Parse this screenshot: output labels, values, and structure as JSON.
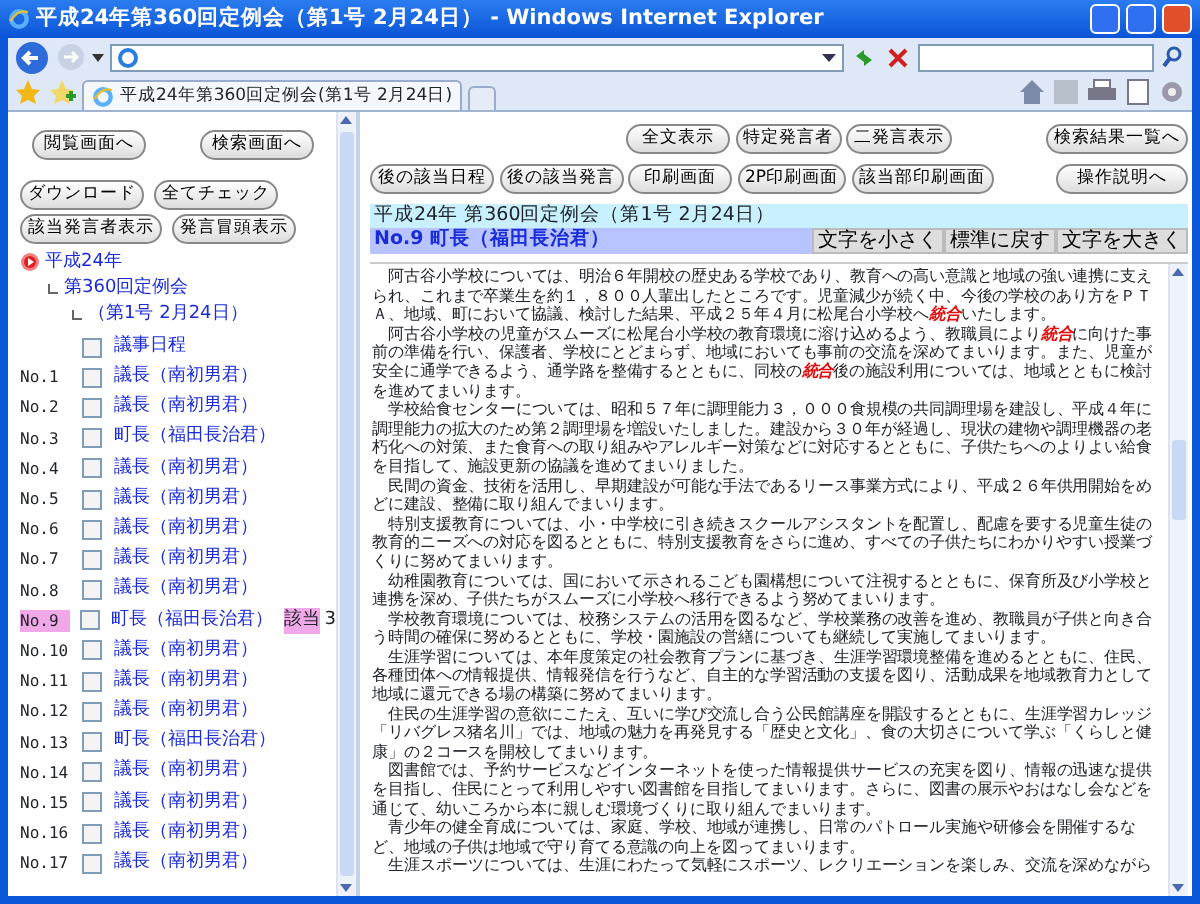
{
  "window": {
    "title": "平成24年第360回定例会（第1号 2月24日） - Windows Internet Explorer"
  },
  "browser": {
    "tab_title": "平成24年第360回定例会(第1号 2月24日)"
  },
  "left_panel": {
    "nav_buttons": [
      "閲覧画面へ",
      "検索画面へ"
    ],
    "tool_buttons": [
      [
        "ダウンロード",
        "全てチェック"
      ],
      [
        "該当発言者表示",
        "発言冒頭表示"
      ]
    ],
    "tree": [
      {
        "label": "平成24年",
        "children": [
          {
            "label": "第360回定例会",
            "children": [
              {
                "label": "（第1号 2月24日）"
              }
            ]
          }
        ]
      }
    ],
    "items": [
      {
        "label": "議事日程",
        "checked": false,
        "selected": false
      },
      {
        "number": "No.1",
        "label": "議長（南初男君）",
        "checked": false,
        "selected": false
      },
      {
        "number": "No.2",
        "label": "議長（南初男君）",
        "checked": false,
        "selected": false
      },
      {
        "number": "No.3",
        "label": "町長（福田長治君）",
        "checked": false,
        "selected": false
      },
      {
        "number": "No.4",
        "label": "議長（南初男君）",
        "checked": false,
        "selected": false
      },
      {
        "number": "No.5",
        "label": "議長（南初男君）",
        "checked": false,
        "selected": false
      },
      {
        "number": "No.6",
        "label": "議長（南初男君）",
        "checked": false,
        "selected": false
      },
      {
        "number": "No.7",
        "label": "議長（南初男君）",
        "checked": false,
        "selected": false
      },
      {
        "number": "No.8",
        "label": "議長（南初男君）",
        "checked": false,
        "selected": false
      },
      {
        "number": "No.9",
        "label": "町長（福田長治君）",
        "checked": false,
        "selected": true,
        "hit_label": "該当",
        "hit_count": "3"
      },
      {
        "number": "No.10",
        "label": "議長（南初男君）",
        "checked": false,
        "selected": false
      },
      {
        "number": "No.11",
        "label": "議長（南初男君）",
        "checked": false,
        "selected": false
      },
      {
        "number": "No.12",
        "label": "議長（南初男君）",
        "checked": false,
        "selected": false
      },
      {
        "number": "No.13",
        "label": "町長（福田長治君）",
        "checked": false,
        "selected": false
      },
      {
        "number": "No.14",
        "label": "議長（南初男君）",
        "checked": false,
        "selected": false
      },
      {
        "number": "No.15",
        "label": "議長（南初男君）",
        "checked": false,
        "selected": false
      },
      {
        "number": "No.16",
        "label": "議長（南初男君）",
        "checked": false,
        "selected": false
      },
      {
        "number": "No.17",
        "label": "議長（南初男君）",
        "checked": false,
        "selected": false
      }
    ]
  },
  "right_panel": {
    "button_rows": [
      [
        "全文表示",
        "特定発言者",
        "二発言表示",
        "検索結果一覧へ"
      ],
      [
        "後の該当日程",
        "後の該当発言",
        "印刷画面",
        "2P印刷画面",
        "該当部印刷画面",
        "操作説明へ"
      ]
    ],
    "session_title": "平成24年 第360回定例会（第1号 2月24日）",
    "speaker": "No.9 町長（福田長治君）",
    "font_buttons": [
      "文字を小さく",
      "標準に戻す",
      "文字を大きく"
    ],
    "paragraphs": [
      "阿古谷小学校については、明治６年開校の歴史ある学校であり、教育への高い意識と地域の強い連携に支えられ、これまで卒業生を約１，８００人輩出したところです。児童減少が続く中、今後の学校のあり方をＰＴＡ、地域、町において協議、検討した結果、平成２５年４月に松尾台小学校へ**統合**いたします。",
      "阿古谷小学校の児童がスムーズに松尾台小学校の教育環境に溶け込めるよう、教職員により**統合**に向けた事前の準備を行い、保護者、学校にとどまらず、地域においても事前の交流を深めてまいります。また、児童が安全に通学できるよう、通学路を整備するとともに、同校の**統合**後の施設利用については、地域とともに検討を進めてまいります。",
      "学校給食センターについては、昭和５７年に調理能力３，０００食規模の共同調理場を建設し、平成４年に調理能力の拡大のため第２調理場を増設いたしました。建設から３０年が経過し、現状の建物や調理機器の老朽化への対策、また食育への取り組みやアレルギー対策などに対応するとともに、子供たちへのよりよい給食を目指して、施設更新の協議を進めてまいりました。",
      "民間の資金、技術を活用し、早期建設が可能な手法であるリース事業方式により、平成２６年供用開始をめどに建設、整備に取り組んでまいります。",
      "特別支援教育については、小・中学校に引き続きスクールアシスタントを配置し、配慮を要する児童生徒の教育的ニーズへの対応を図るとともに、特別支援教育をさらに進め、すべての子供たちにわかりやすい授業づくりに努めてまいります。",
      "幼稚園教育については、国において示されるこども園構想について注視するとともに、保育所及び小学校と連携を深め、子供たちがスムーズに小学校へ移行できるよう努めてまいります。",
      "学校教育環境については、校務システムの活用を図るなど、学校業務の改善を進め、教職員が子供と向き合う時間の確保に努めるとともに、学校・園施設の営繕についても継続して実施してまいります。",
      "生涯学習については、本年度策定の社会教育プランに基づき、生涯学習環境整備を進めるとともに、住民、各種団体への情報提供、情報発信を行うなど、自主的な学習活動の支援を図り、活動成果を地域教育力として地域に還元できる場の構築に努めてまいります。",
      "住民の生涯学習の意欲にこたえ、互いに学び交流し合う公民館講座を開設するとともに、生涯学習カレッジ「リバグレス猪名川」では、地域の魅力を再発見する「歴史と文化」、食の大切さについて学ぶ「くらしと健康」の２コースを開校してまいります。",
      "図書館では、予約サービスなどインターネットを使った情報提供サービスの充実を図り、情報の迅速な提供を目指し、住民にとって利用しやすい図書館を目指してまいります。さらに、図書の展示やおはなし会などを通じて、幼いころから本に親しむ環境づくりに取り組んでまいります。",
      "青少年の健全育成については、家庭、学校、地域が連携し、日常のパトロール実施や研修会を開催するなど、地域の子供は地域で守り育てる意識の向上を図ってまいります。",
      "生涯スポーツについては、生涯にわたって気軽にスポーツ、レクリエーションを楽しみ、交流を深めながら"
    ]
  }
}
